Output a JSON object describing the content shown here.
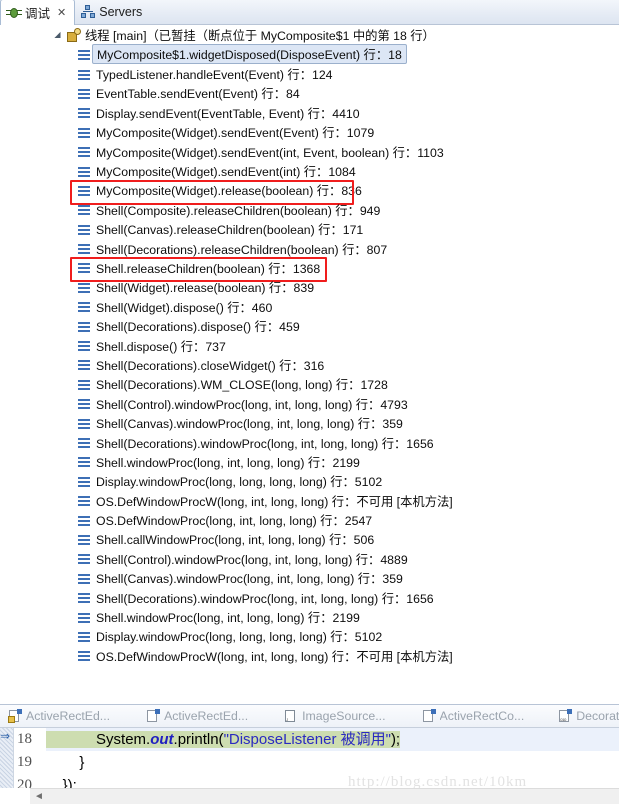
{
  "view_tabs": [
    {
      "label": "调试",
      "icon": "bug-icon",
      "active": true,
      "closeable": true
    },
    {
      "label": "Servers",
      "icon": "servers-icon",
      "active": false,
      "closeable": false
    }
  ],
  "close_glyph": "✕",
  "twisty_glyph": "◢",
  "thread": {
    "icon": "thread-icon",
    "label": "线程 [main]（已暂挂（断点位于 MyComposite$1 中的第 18 行）"
  },
  "frames": [
    {
      "text": "MyComposite$1.widgetDisposed(DisposeEvent) 行：18",
      "selected": true,
      "boxed": false
    },
    {
      "text": "TypedListener.handleEvent(Event) 行：124",
      "selected": false,
      "boxed": false
    },
    {
      "text": "EventTable.sendEvent(Event) 行：84",
      "selected": false,
      "boxed": false
    },
    {
      "text": "Display.sendEvent(EventTable, Event) 行：4410",
      "selected": false,
      "boxed": false
    },
    {
      "text": "MyComposite(Widget).sendEvent(Event) 行：1079",
      "selected": false,
      "boxed": false
    },
    {
      "text": "MyComposite(Widget).sendEvent(int, Event, boolean) 行：1103",
      "selected": false,
      "boxed": false
    },
    {
      "text": "MyComposite(Widget).sendEvent(int) 行：1084",
      "selected": false,
      "boxed": false
    },
    {
      "text": "MyComposite(Widget).release(boolean) 行：836",
      "selected": false,
      "boxed": "b1"
    },
    {
      "text": "Shell(Composite).releaseChildren(boolean) 行：949",
      "selected": false,
      "boxed": false
    },
    {
      "text": "Shell(Canvas).releaseChildren(boolean) 行：171",
      "selected": false,
      "boxed": false
    },
    {
      "text": "Shell(Decorations).releaseChildren(boolean) 行：807",
      "selected": false,
      "boxed": false
    },
    {
      "text": "Shell.releaseChildren(boolean) 行：1368",
      "selected": false,
      "boxed": "b2"
    },
    {
      "text": "Shell(Widget).release(boolean) 行：839",
      "selected": false,
      "boxed": false
    },
    {
      "text": "Shell(Widget).dispose() 行：460",
      "selected": false,
      "boxed": false
    },
    {
      "text": "Shell(Decorations).dispose() 行：459",
      "selected": false,
      "boxed": false
    },
    {
      "text": "Shell.dispose() 行：737",
      "selected": false,
      "boxed": false
    },
    {
      "text": "Shell(Decorations).closeWidget() 行：316",
      "selected": false,
      "boxed": false
    },
    {
      "text": "Shell(Decorations).WM_CLOSE(long, long) 行：1728",
      "selected": false,
      "boxed": false
    },
    {
      "text": "Shell(Control).windowProc(long, int, long, long) 行：4793",
      "selected": false,
      "boxed": false
    },
    {
      "text": "Shell(Canvas).windowProc(long, int, long, long) 行：359",
      "selected": false,
      "boxed": false
    },
    {
      "text": "Shell(Decorations).windowProc(long, int, long, long) 行：1656",
      "selected": false,
      "boxed": false
    },
    {
      "text": "Shell.windowProc(long, int, long, long) 行：2199",
      "selected": false,
      "boxed": false
    },
    {
      "text": "Display.windowProc(long, long, long, long) 行：5102",
      "selected": false,
      "boxed": false
    },
    {
      "text": "OS.DefWindowProcW(long, int, long, long) 行：不可用 [本机方法]",
      "selected": false,
      "boxed": false
    },
    {
      "text": "OS.DefWindowProc(long, int, long, long) 行：2547",
      "selected": false,
      "boxed": false
    },
    {
      "text": "Shell.callWindowProc(long, int, long, long) 行：506",
      "selected": false,
      "boxed": false
    },
    {
      "text": "Shell(Control).windowProc(long, int, long, long) 行：4889",
      "selected": false,
      "boxed": false
    },
    {
      "text": "Shell(Canvas).windowProc(long, int, long, long) 行：359",
      "selected": false,
      "boxed": false
    },
    {
      "text": "Shell(Decorations).windowProc(long, int, long, long) 行：1656",
      "selected": false,
      "boxed": false
    },
    {
      "text": "Shell.windowProc(long, int, long, long) 行：2199",
      "selected": false,
      "boxed": false
    },
    {
      "text": "Display.windowProc(long, long, long, long) 行：5102",
      "selected": false,
      "boxed": false
    },
    {
      "text": "OS.DefWindowProcW(long, int, long, long) 行：不可用 [本机方法]",
      "selected": false,
      "boxed": false
    }
  ],
  "editor_tabs": [
    {
      "label": "ActiveRectEd...",
      "icon": "java-file-warning-icon"
    },
    {
      "label": "ActiveRectEd...",
      "icon": "java-file-icon"
    },
    {
      "label": "ImageSource...",
      "icon": "source-file-icon"
    },
    {
      "label": "ActiveRectCo...",
      "icon": "java-file-icon"
    },
    {
      "label": "Decoration",
      "icon": "binary-file-icon"
    }
  ],
  "code": {
    "arrow_glyph": "⇒",
    "lines": [
      {
        "num": "18",
        "highlight": true,
        "parts": [
          {
            "t": "            ",
            "style": "plain"
          },
          {
            "t": "System.",
            "style": "plain"
          },
          {
            "t": "out",
            "style": "kw-italic"
          },
          {
            "t": ".println(",
            "style": "plain"
          },
          {
            "t": "\"DisposeListener 被调用\"",
            "style": "str"
          },
          {
            "t": ");",
            "style": "plain"
          }
        ]
      },
      {
        "num": "19",
        "highlight": false,
        "parts": [
          {
            "t": "        }",
            "style": "plain"
          }
        ]
      },
      {
        "num": "20",
        "highlight": false,
        "parts": [
          {
            "t": "    });",
            "style": "plain"
          }
        ]
      }
    ],
    "watermark": "http://blog.csdn.net/10km"
  },
  "scrollbar": {
    "left_arrow": "◄"
  },
  "colors": {
    "selection_bg": "#dce6f5",
    "selection_border": "#9bb0cc",
    "annotation_red": "#f01d1d",
    "code_highlight": "#cdddb0",
    "current_line": "#ebf1fb",
    "string_blue": "#2a2ac0",
    "tree_icon_blue": "#3d6fb5"
  }
}
